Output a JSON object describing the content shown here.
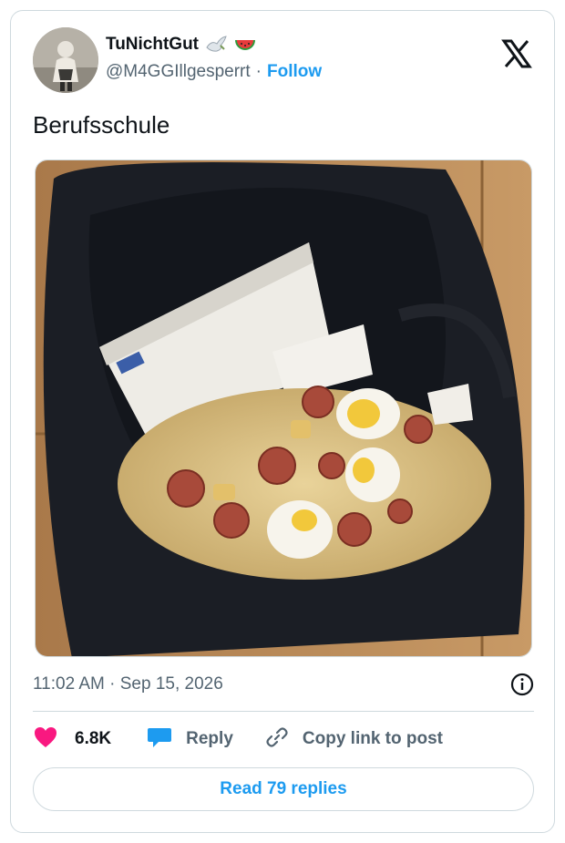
{
  "tweet": {
    "display_name": "TuNichtGut",
    "handle": "@M4GGIllgesperrt",
    "separator": "·",
    "follow_label": "Follow",
    "text": "Berufsschule",
    "timestamp": "11:02 AM · Sep 15, 2026",
    "emojis": [
      "dove-emoji",
      "watermelon-emoji"
    ],
    "photo_icon": "backpack-food-photo"
  },
  "actions": {
    "likes": "6.8K",
    "reply_label": "Reply",
    "copy_link_label": "Copy link to post"
  },
  "footer": {
    "read_replies_label": "Read 79 replies"
  },
  "colors": {
    "accent": "#1d9bf0",
    "like": "#f91880",
    "muted": "#536471",
    "border": "#cfd9de"
  }
}
